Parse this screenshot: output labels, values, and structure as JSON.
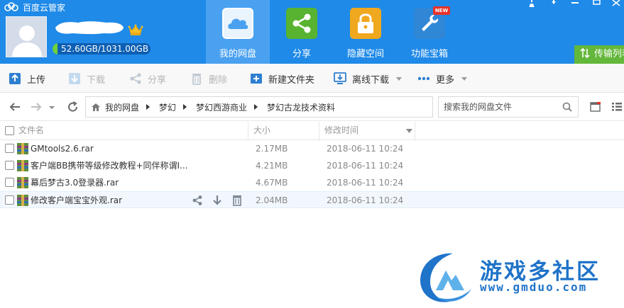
{
  "window": {
    "title": "百度云管家",
    "controls": [
      "bell-icon",
      "menu-icon",
      "minimize-icon",
      "maximize-icon",
      "close-icon"
    ]
  },
  "user": {
    "storage_text": "52.60GB/1031.00GB",
    "storage_used_fraction": 0.051
  },
  "nav_tabs": [
    {
      "label": "我的网盘",
      "icon": "cloud-icon",
      "active": true
    },
    {
      "label": "分享",
      "icon": "share-icon",
      "active": false
    },
    {
      "label": "隐藏空间",
      "icon": "lock-icon",
      "active": false
    },
    {
      "label": "功能宝箱",
      "icon": "toolbox-icon",
      "badge": "NEW",
      "active": false
    }
  ],
  "transfer_button": "传输列表",
  "toolbar": {
    "upload": "上传",
    "download": "下载",
    "share": "分享",
    "delete": "删除",
    "new_folder": "新建文件夹",
    "offline_download": "离线下载",
    "more": "更多"
  },
  "breadcrumb": [
    "我的网盘",
    "梦幻",
    "梦幻西游商业",
    "梦幻古龙技术资料"
  ],
  "search": {
    "placeholder": "搜索我的网盘文件"
  },
  "columns": {
    "name": "文件名",
    "size": "大小",
    "modified": "修改时间"
  },
  "files": [
    {
      "name": "GMtools2.6.rar",
      "size": "2.17MB",
      "modified": "2018-06-11 10:24"
    },
    {
      "name": "客户端BB携带等级修改教程+同伴称谓I...",
      "size": "4.21MB",
      "modified": "2018-06-11 10:24"
    },
    {
      "name": "幕后梦古3.0登录器.rar",
      "size": "4.67MB",
      "modified": "2018-06-11 10:24"
    },
    {
      "name": "修改客户端宝宝外观.rar",
      "size": "2.04MB",
      "modified": "2018-06-11 10:24",
      "hovered": true
    }
  ],
  "watermark": {
    "title": "游戏多社区",
    "url": "www.gmduo.com"
  },
  "colors": {
    "header": "#1f8ae8",
    "active_tab": "#4aa1f0",
    "transfer_button": "#63b73a",
    "quota_fill": "#6fd13c",
    "watermark": "#1f73c9"
  }
}
